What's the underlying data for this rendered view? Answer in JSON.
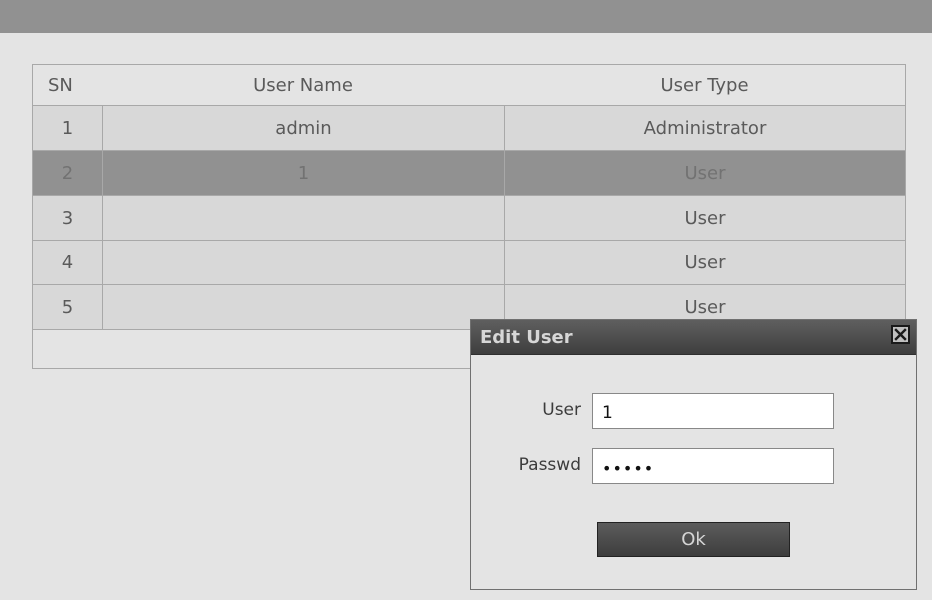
{
  "table": {
    "headers": {
      "sn": "SN",
      "user_name": "User Name",
      "user_type": "User Type"
    },
    "rows": [
      {
        "sn": "1",
        "user_name": "admin",
        "user_type": "Administrator",
        "selected": false
      },
      {
        "sn": "2",
        "user_name": "1",
        "user_type": "User",
        "selected": true
      },
      {
        "sn": "3",
        "user_name": "",
        "user_type": "User",
        "selected": false
      },
      {
        "sn": "4",
        "user_name": "",
        "user_type": "User",
        "selected": false
      },
      {
        "sn": "5",
        "user_name": "",
        "user_type": "User",
        "selected": false
      }
    ]
  },
  "dialog": {
    "title": "Edit User",
    "close_icon": "close-icon",
    "user_label": "User",
    "user_value": "1",
    "passwd_label": "Passwd",
    "passwd_value": "•••••",
    "ok_label": "Ok"
  },
  "colors": {
    "background": "#e4e4e4",
    "top_bar": "#919191",
    "row": "#d8d8d8",
    "selected_row": "#919191",
    "dialog_titlebar": "#4b4b4b"
  }
}
